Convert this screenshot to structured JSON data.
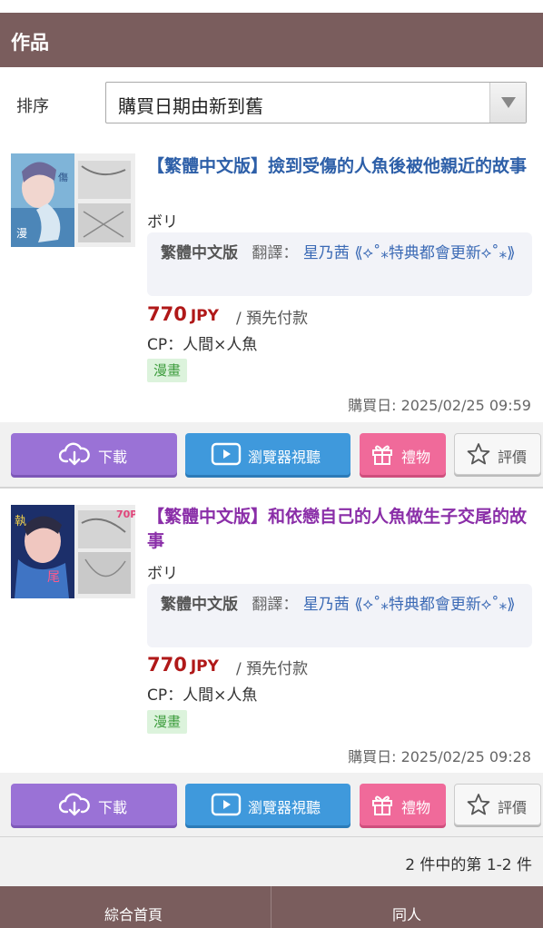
{
  "header": {
    "title": "作品"
  },
  "sort": {
    "label": "排序",
    "selected": "購買日期由新到舊"
  },
  "items": [
    {
      "title": "【繁體中文版】撿到受傷的人魚後被他親近的故事",
      "title_color": "#2d5fa8",
      "author": "ボリ",
      "translation": {
        "lang": "繁體中文版",
        "label": "翻譯：",
        "translator": "星乃茜 ⟪⟡˚⁎特典都會更新⟡˚⁎⟫"
      },
      "price": "770",
      "currency": "JPY",
      "price_note": "/ 預先付款",
      "cp": "CP：人間×人魚",
      "tag": "漫畫",
      "purchase_date": "購買日: 2025/02/25 09:59"
    },
    {
      "title": "【繁體中文版】和依戀自己的人魚做生子交尾的故事",
      "title_color": "#8a2ea8",
      "author": "ボリ",
      "translation": {
        "lang": "繁體中文版",
        "label": "翻譯：",
        "translator": "星乃茜 ⟪⟡˚⁎特典都會更新⟡˚⁎⟫"
      },
      "price": "770",
      "currency": "JPY",
      "price_note": "/ 預先付款",
      "cp": "CP：人間×人魚",
      "tag": "漫畫",
      "purchase_date": "購買日: 2025/02/25 09:28"
    }
  ],
  "buttons": {
    "download": "下載",
    "browser": "瀏覽器視聽",
    "gift": "禮物",
    "rate": "評價"
  },
  "pager": {
    "text": "2 件中的第 1-2 件"
  },
  "footer": {
    "home": "綜合首頁",
    "doujin": "同人"
  },
  "colors": {
    "header_bg": "#7a5d5d",
    "price": "#b01818",
    "tag_bg": "#dcf3dc"
  }
}
